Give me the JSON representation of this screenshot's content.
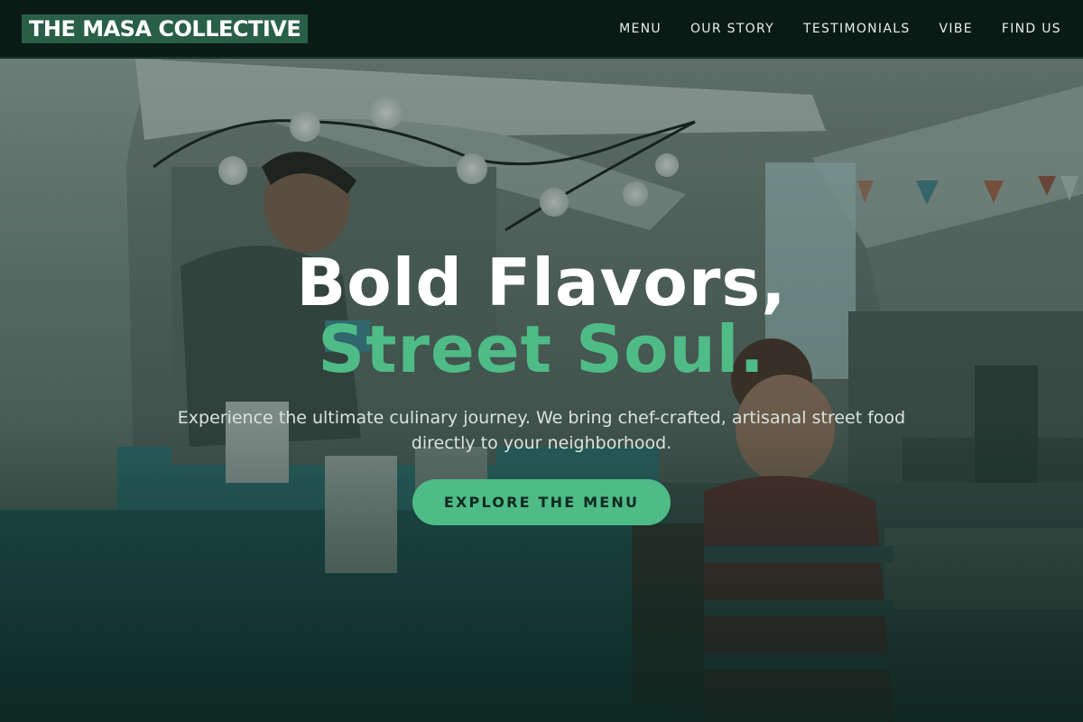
{
  "navbar": {
    "brand": "THE MASA COLLECTIVE",
    "links": [
      "MENU",
      "OUR STORY",
      "TESTIMONIALS",
      "VIBE",
      "FIND US"
    ]
  },
  "hero": {
    "headline": "Bold Flavors,",
    "headline_accent": "Street Soul.",
    "subtext": "Experience the ultimate culinary journey. We bring chef-crafted, artisanal street food directly to your neighborhood.",
    "cta_label": "EXPLORE THE MENU"
  },
  "colors": {
    "nav_background": "#0a1b16",
    "brand_background": "#2a5f47",
    "accent": "#4fbb87",
    "overlay": "#0a221c"
  }
}
